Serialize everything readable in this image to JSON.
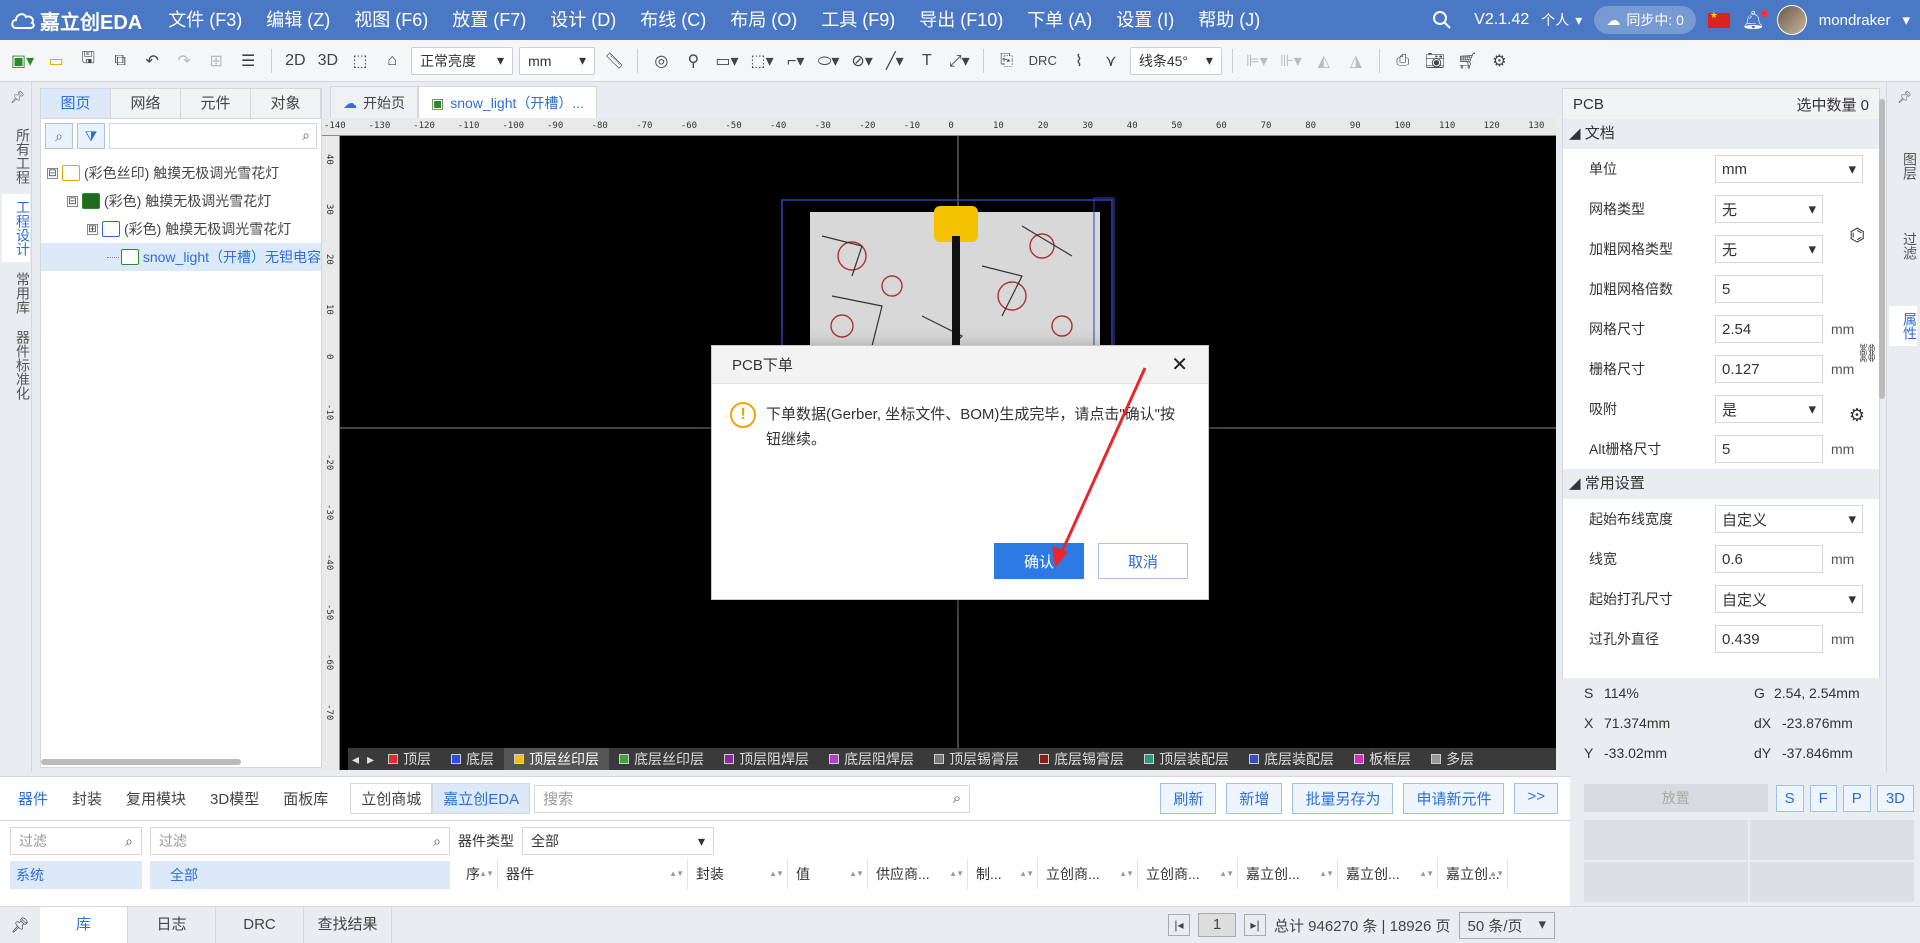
{
  "app": {
    "logo_text": "嘉立创EDA",
    "version": "V2.1.42",
    "personal_label": "个人",
    "sync_label": "同步中: 0",
    "username": "mondraker"
  },
  "menu": [
    "文件 (F3)",
    "编辑 (Z)",
    "视图 (F6)",
    "放置 (F7)",
    "设计 (D)",
    "布线 (C)",
    "布局 (O)",
    "工具 (F9)",
    "导出 (F10)",
    "下单 (A)",
    "设置 (I)",
    "帮助 (J)"
  ],
  "toolbar": {
    "view_2d": "2D",
    "view_3d": "3D",
    "brightness": "正常亮度",
    "unit": "mm",
    "drc_label": "DRC",
    "route_angle": "线条45°"
  },
  "left_vtabs": [
    "所有工程",
    "工程设计",
    "常用库",
    "器件标准化"
  ],
  "left_panel": {
    "tabs": [
      "图页",
      "网络",
      "元件",
      "对象"
    ],
    "tree": [
      {
        "label": "(彩色丝印)  触摸无极调光雪花灯",
        "toggle": "⊟"
      },
      {
        "label": "(彩色) 触摸无极调光雪花灯",
        "toggle": "⊟"
      },
      {
        "label": "(彩色) 触摸无极调光雪花灯",
        "toggle": "⊞"
      },
      {
        "label": "snow_light（开槽）无钽电容",
        "toggle": ""
      }
    ]
  },
  "canvas_tabs": [
    "开始页",
    "snow_light（开槽）..."
  ],
  "ruler_h": [
    "-140",
    "-130",
    "-120",
    "-110",
    "-100",
    "-90",
    "-80",
    "-70",
    "-60",
    "-50",
    "-40",
    "-30",
    "-20",
    "-10",
    "0",
    "10",
    "20",
    "30",
    "40",
    "50",
    "60",
    "70",
    "80",
    "90",
    "100",
    "110",
    "120",
    "130"
  ],
  "ruler_v": [
    "40",
    "30",
    "20",
    "10",
    "0",
    "-10",
    "-20",
    "-30",
    "-40",
    "-50",
    "-60",
    "-70"
  ],
  "layers": [
    {
      "name": "顶层",
      "color": "#e8262b"
    },
    {
      "name": "底层",
      "color": "#2f45ff"
    },
    {
      "name": "顶层丝印层",
      "color": "#f4c200"
    },
    {
      "name": "底层丝印层",
      "color": "#3ea33e"
    },
    {
      "name": "顶层阻焊层",
      "color": "#8a2c9e"
    },
    {
      "name": "底层阻焊层",
      "color": "#b040c8"
    },
    {
      "name": "顶层锡膏层",
      "color": "#7a7a7a"
    },
    {
      "name": "底层锡膏层",
      "color": "#8b1c1c"
    },
    {
      "name": "顶层装配层",
      "color": "#2a9a7c"
    },
    {
      "name": "底层装配层",
      "color": "#3a4fbe"
    },
    {
      "name": "板框层",
      "color": "#d22ec8"
    },
    {
      "name": "多层",
      "color": "#999999"
    }
  ],
  "right_vtabs": [
    "图层",
    "过滤",
    "属性"
  ],
  "right_panel": {
    "title": "PCB",
    "selected_count": "选中数量 0",
    "section_doc": "文档",
    "section_common": "常用设置",
    "props": [
      {
        "label": "单位",
        "value": "mm",
        "select": true,
        "unit": ""
      },
      {
        "label": "网格类型",
        "value": "无",
        "select": true,
        "unit": ""
      },
      {
        "label": "加粗网格类型",
        "value": "无",
        "select": true,
        "unit": ""
      },
      {
        "label": "加粗网格倍数",
        "value": "5",
        "select": false,
        "unit": ""
      },
      {
        "label": "网格尺寸",
        "value": "2.54",
        "select": false,
        "unit": "mm"
      },
      {
        "label": "栅格尺寸",
        "value": "0.127",
        "select": false,
        "unit": "mm"
      },
      {
        "label": "吸附",
        "value": "是",
        "select": true,
        "unit": ""
      },
      {
        "label": "Alt栅格尺寸",
        "value": "5",
        "select": false,
        "unit": "mm"
      }
    ],
    "common_props": [
      {
        "label": "起始布线宽度",
        "value": "自定义",
        "select": true,
        "unit": ""
      },
      {
        "label": "线宽",
        "value": "0.6",
        "select": false,
        "unit": "mm"
      },
      {
        "label": "起始打孔尺寸",
        "value": "自定义",
        "select": true,
        "unit": ""
      },
      {
        "label": "过孔外直径",
        "value": "0.439",
        "select": false,
        "unit": "mm"
      }
    ]
  },
  "status": {
    "s_label": "S",
    "s_value": "114%",
    "g_label": "G",
    "g_value": "2.54, 2.54mm",
    "x_label": "X",
    "x_value": "71.374mm",
    "dx_label": "dX",
    "dx_value": "-23.876mm",
    "y_label": "Y",
    "y_value": "-33.02mm",
    "dy_label": "dY",
    "dy_value": "-37.846mm"
  },
  "bottom_panel": {
    "tabs": [
      "器件",
      "封装",
      "复用模块",
      "3D模型",
      "面板库"
    ],
    "sources": [
      "立创商城",
      "嘉立创EDA"
    ],
    "search_placeholder": "搜索",
    "buttons": [
      "刷新",
      "新增",
      "批量另存为",
      "申请新元件",
      ">>"
    ],
    "filter_placeholder": "过滤",
    "filter2_placeholder": "过滤",
    "category_label": "器件类型",
    "category_value": "全部",
    "tree_root": "系统",
    "tree_all": "全部",
    "columns": [
      "序",
      "器件",
      "封装",
      "值",
      "供应商...",
      "制...",
      "立创商...",
      "立创商...",
      "嘉立创...",
      "嘉立创...",
      "嘉立创..."
    ]
  },
  "place_panel": {
    "place_label": "放置",
    "buttons": [
      "S",
      "F",
      "P",
      "3D"
    ]
  },
  "bottom_bar": {
    "tabs": [
      "库",
      "日志",
      "DRC",
      "查找结果"
    ],
    "page": "1",
    "total": "总计 946270 条 | 18926 页",
    "per_page": "50 条/页"
  },
  "modal": {
    "title": "PCB下单",
    "message": "下单数据(Gerber, 坐标文件、BOM)生成完毕，请点击\"确认\"按钮继续。",
    "confirm": "确认",
    "cancel": "取消"
  }
}
